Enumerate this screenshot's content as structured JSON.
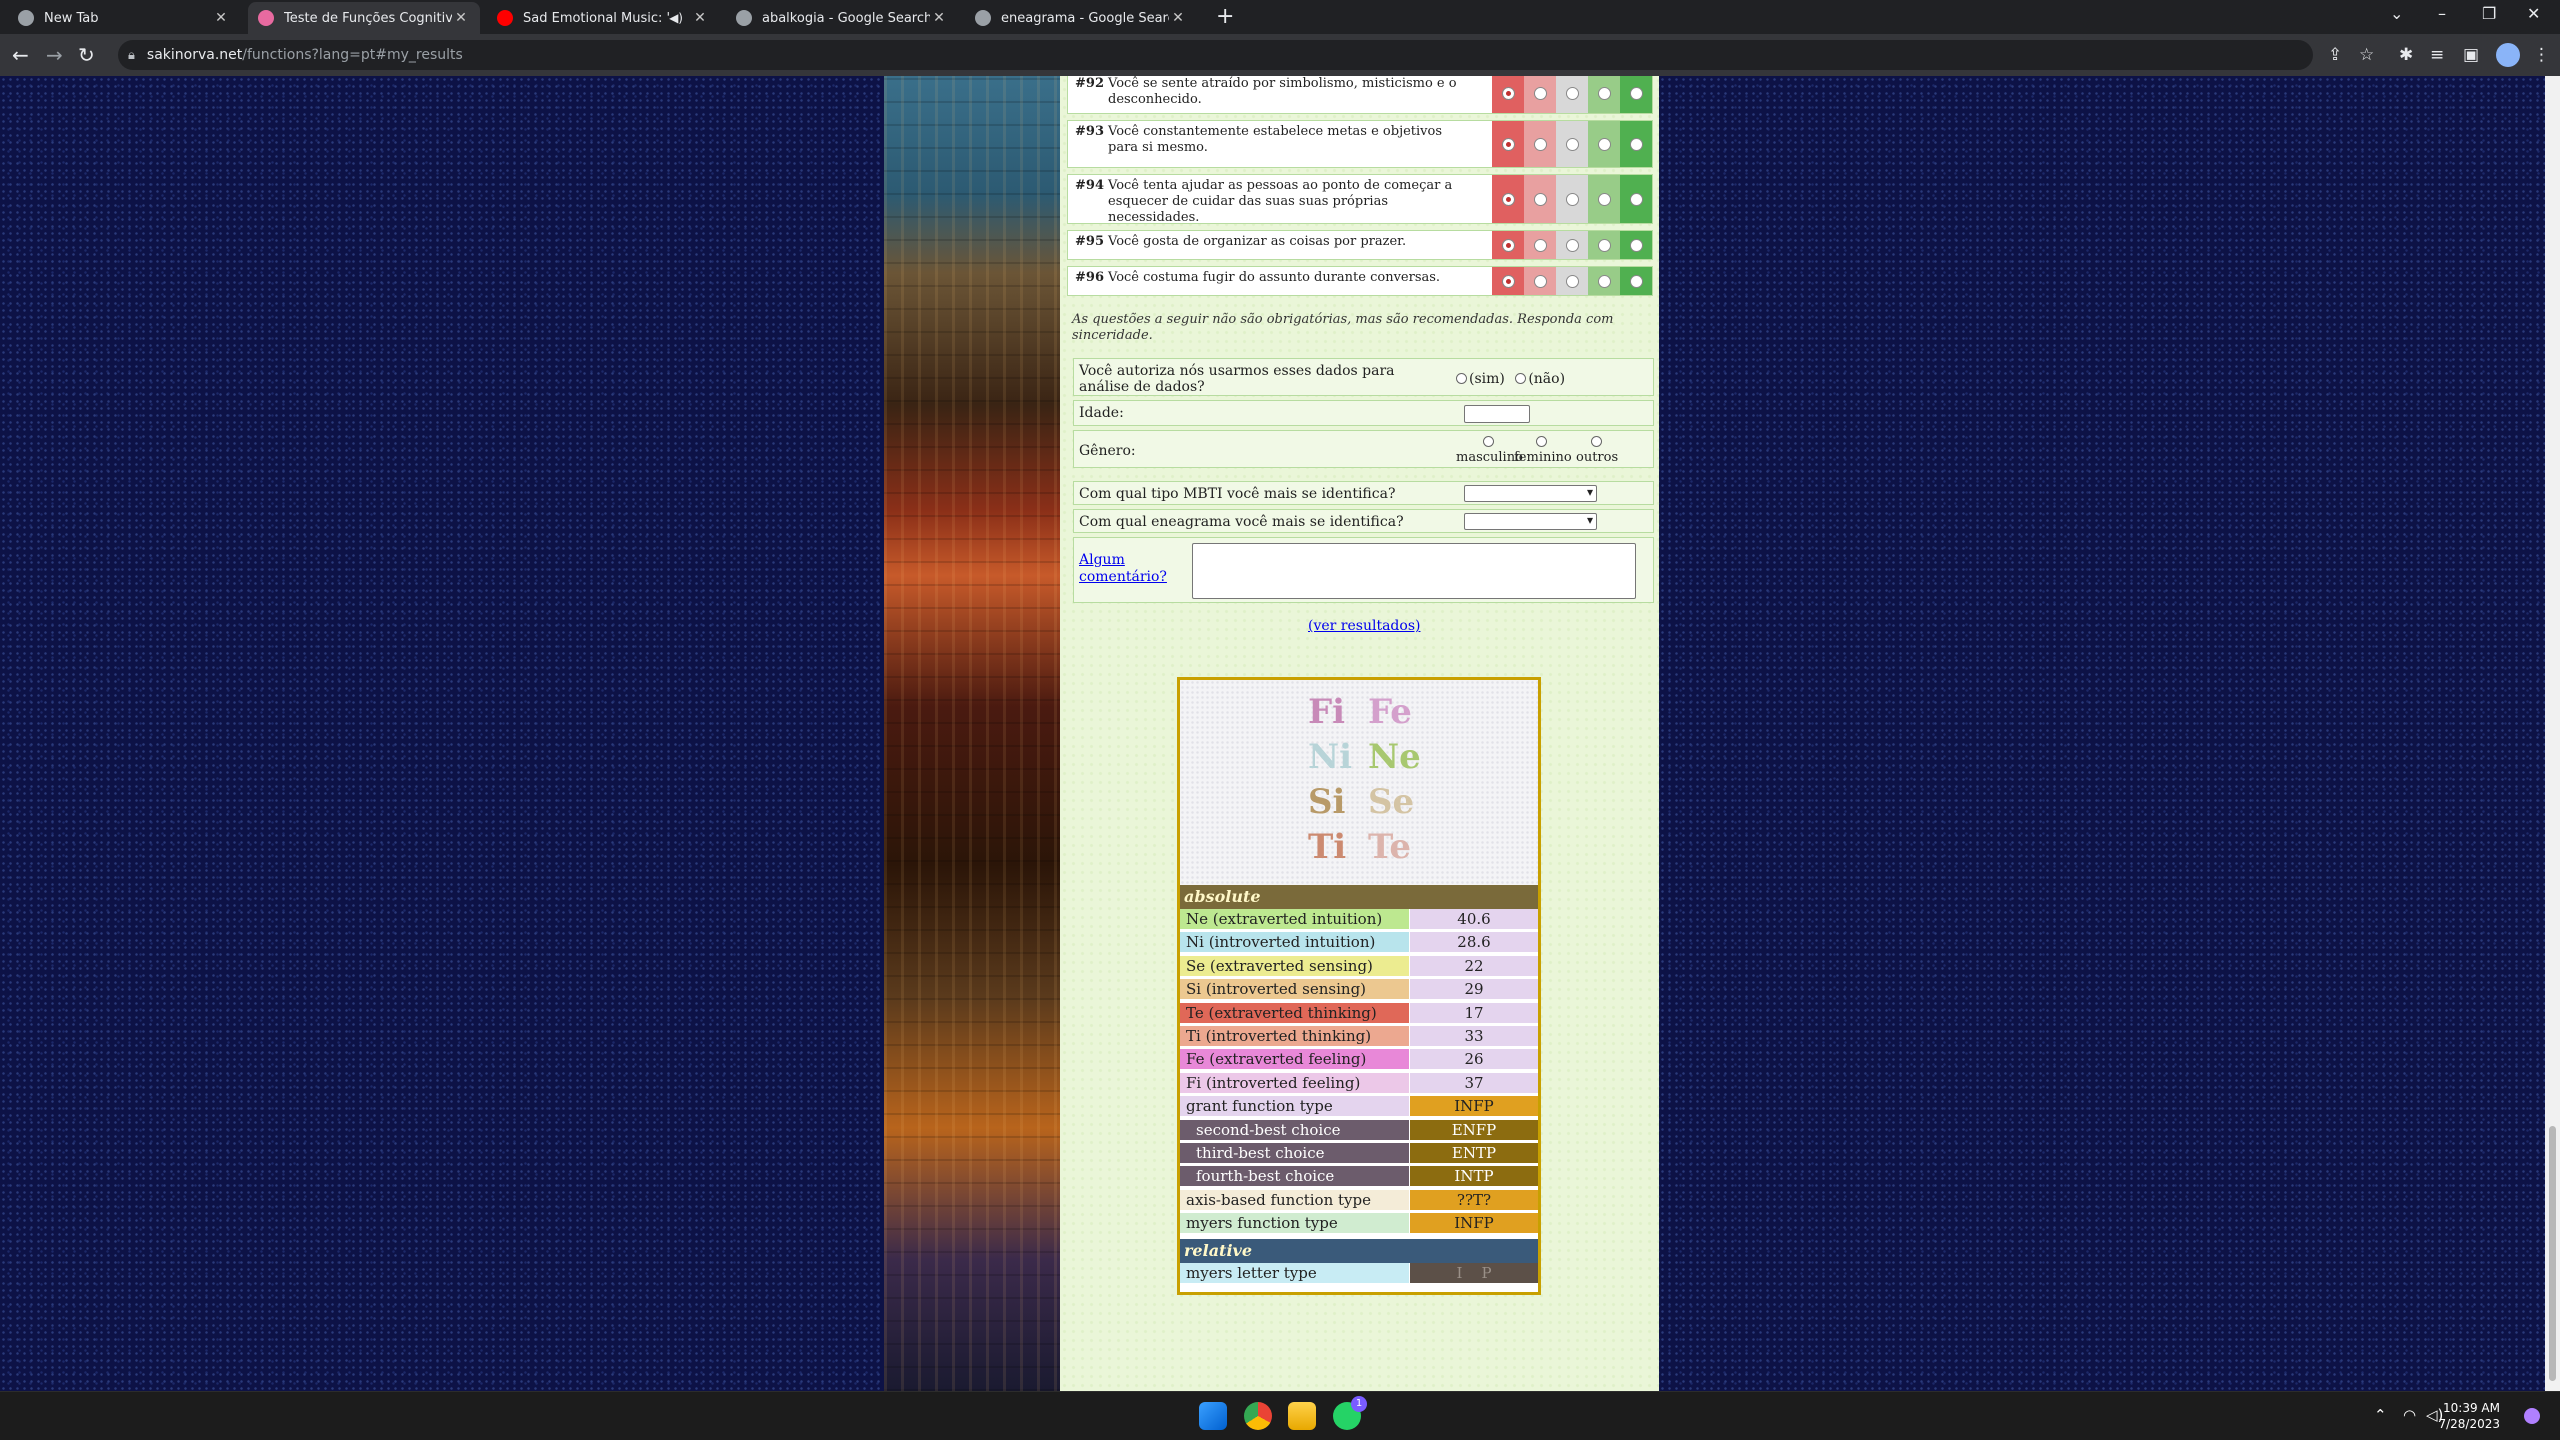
{
  "browser": {
    "tabs": [
      {
        "title": "New Tab",
        "active": false,
        "favicon_color": "#9aa0a6"
      },
      {
        "title": "Teste de Funções Cognitivas - Sa",
        "active": true,
        "favicon_color": "#e86aa0"
      },
      {
        "title": "Sad Emotional Music: \"Krone",
        "active": false,
        "favicon_color": "#ff0000",
        "audio": true
      },
      {
        "title": "abalkogia - Google Search",
        "active": false,
        "favicon_color": "#9aa0a6"
      },
      {
        "title": "eneagrama - Google Search",
        "active": false,
        "favicon_color": "#9aa0a6"
      }
    ],
    "url_domain": "sakinorva.net",
    "url_path": "/functions?lang=pt#my_results"
  },
  "questions": [
    {
      "num": "#92",
      "text": "Você se sente atraído por simbolismo, misticismo e o desconhecido."
    },
    {
      "num": "#93",
      "text": "Você constantemente estabelece metas e objetivos para si mesmo."
    },
    {
      "num": "#94",
      "text": "Você tenta ajudar as pessoas ao ponto de começar a esquecer de cuidar das suas suas próprias necessidades."
    },
    {
      "num": "#95",
      "text": "Você gosta de organizar as coisas por prazer."
    },
    {
      "num": "#96",
      "text": "Você costuma fugir do assunto durante conversas."
    }
  ],
  "scale_colors": [
    "#e06060",
    "#e8a0a0",
    "#d8d8d8",
    "#98cc88",
    "#50b050"
  ],
  "selected_scale": 0,
  "optional_note": "As questões a seguir não são obrigatórias, mas são recomendadas. Responda com sinceridade.",
  "form": {
    "consent_label": "Você autoriza nós usarmos esses dados para análise de dados?",
    "consent_yes": "(sim)",
    "consent_no": "(não)",
    "age_label": "Idade:",
    "gender_label": "Gênero:",
    "gender_options": [
      "masculino",
      "feminino",
      "outros"
    ],
    "mbti_label": "Com qual tipo MBTI você mais se identifica?",
    "enneagram_label": "Com qual eneagrama você mais se identifica?",
    "comment_link": "Algum comentário?"
  },
  "view_results_link": "(ver resultados)",
  "function_letters": [
    {
      "text": "Fi",
      "color": "#c88ab8"
    },
    {
      "text": "Fe",
      "color": "#d4a0cc"
    },
    {
      "text": "Ni",
      "color": "#b8d4d8"
    },
    {
      "text": "Ne",
      "color": "#a8c870"
    },
    {
      "text": "Si",
      "color": "#b89a68"
    },
    {
      "text": "Se",
      "color": "#d4c4a4"
    },
    {
      "text": "Ti",
      "color": "#cc8a70"
    },
    {
      "text": "Te",
      "color": "#dcb4ac"
    }
  ],
  "results": {
    "absolute_header": "absolute",
    "relative_header": "relative",
    "rows": [
      {
        "label": "Ne (extraverted intuition)",
        "value": "40.6",
        "label_bg": "#bde890",
        "value_bg": "#e4d4ee"
      },
      {
        "label": "Ni (introverted intuition)",
        "value": "28.6",
        "label_bg": "#b8e4ec",
        "value_bg": "#e4d4ee"
      },
      {
        "label": "Se (extraverted sensing)",
        "value": "22",
        "label_bg": "#ecec90",
        "value_bg": "#e4d4ee"
      },
      {
        "label": "Si (introverted sensing)",
        "value": "29",
        "label_bg": "#ecc890",
        "value_bg": "#e4d4ee"
      },
      {
        "label": "Te (extraverted thinking)",
        "value": "17",
        "label_bg": "#e06858",
        "value_bg": "#e4d4ee"
      },
      {
        "label": "Ti (introverted thinking)",
        "value": "33",
        "label_bg": "#eca890",
        "value_bg": "#e4d4ee"
      },
      {
        "label": "Fe (extraverted feeling)",
        "value": "26",
        "label_bg": "#e888d8",
        "value_bg": "#e4d4ee"
      },
      {
        "label": "Fi (introverted feeling)",
        "value": "37",
        "label_bg": "#ecc8e8",
        "value_bg": "#e4d4ee"
      },
      {
        "label": "grant function type",
        "value": "INFP",
        "label_bg": "#e4d4ee",
        "value_bg": "#e0a020"
      },
      {
        "label": "second-best choice",
        "value": "ENFP",
        "label_bg": "#6c5c6c",
        "value_bg": "#8c6c10",
        "dark": true
      },
      {
        "label": "third-best choice",
        "value": "ENTP",
        "label_bg": "#6c5c6c",
        "value_bg": "#8c6c10",
        "dark": true
      },
      {
        "label": "fourth-best choice",
        "value": "INTP",
        "label_bg": "#6c5c6c",
        "value_bg": "#8c6c10",
        "dark": true
      },
      {
        "label": "axis-based function type",
        "value": "??T?",
        "label_bg": "#f4ecd8",
        "value_bg": "#e0a020"
      },
      {
        "label": "myers function type",
        "value": "INFP",
        "label_bg": "#d0ecd0",
        "value_bg": "#e0a020"
      }
    ],
    "relative_rows": [
      {
        "label": "myers letter type",
        "value": "I    P",
        "label_bg": "#c8ecf4",
        "value_bg": "#5c5048"
      }
    ]
  },
  "taskbar": {
    "time": "10:39 AM",
    "date": "7/28/2023",
    "whatsapp_badge": "1"
  }
}
